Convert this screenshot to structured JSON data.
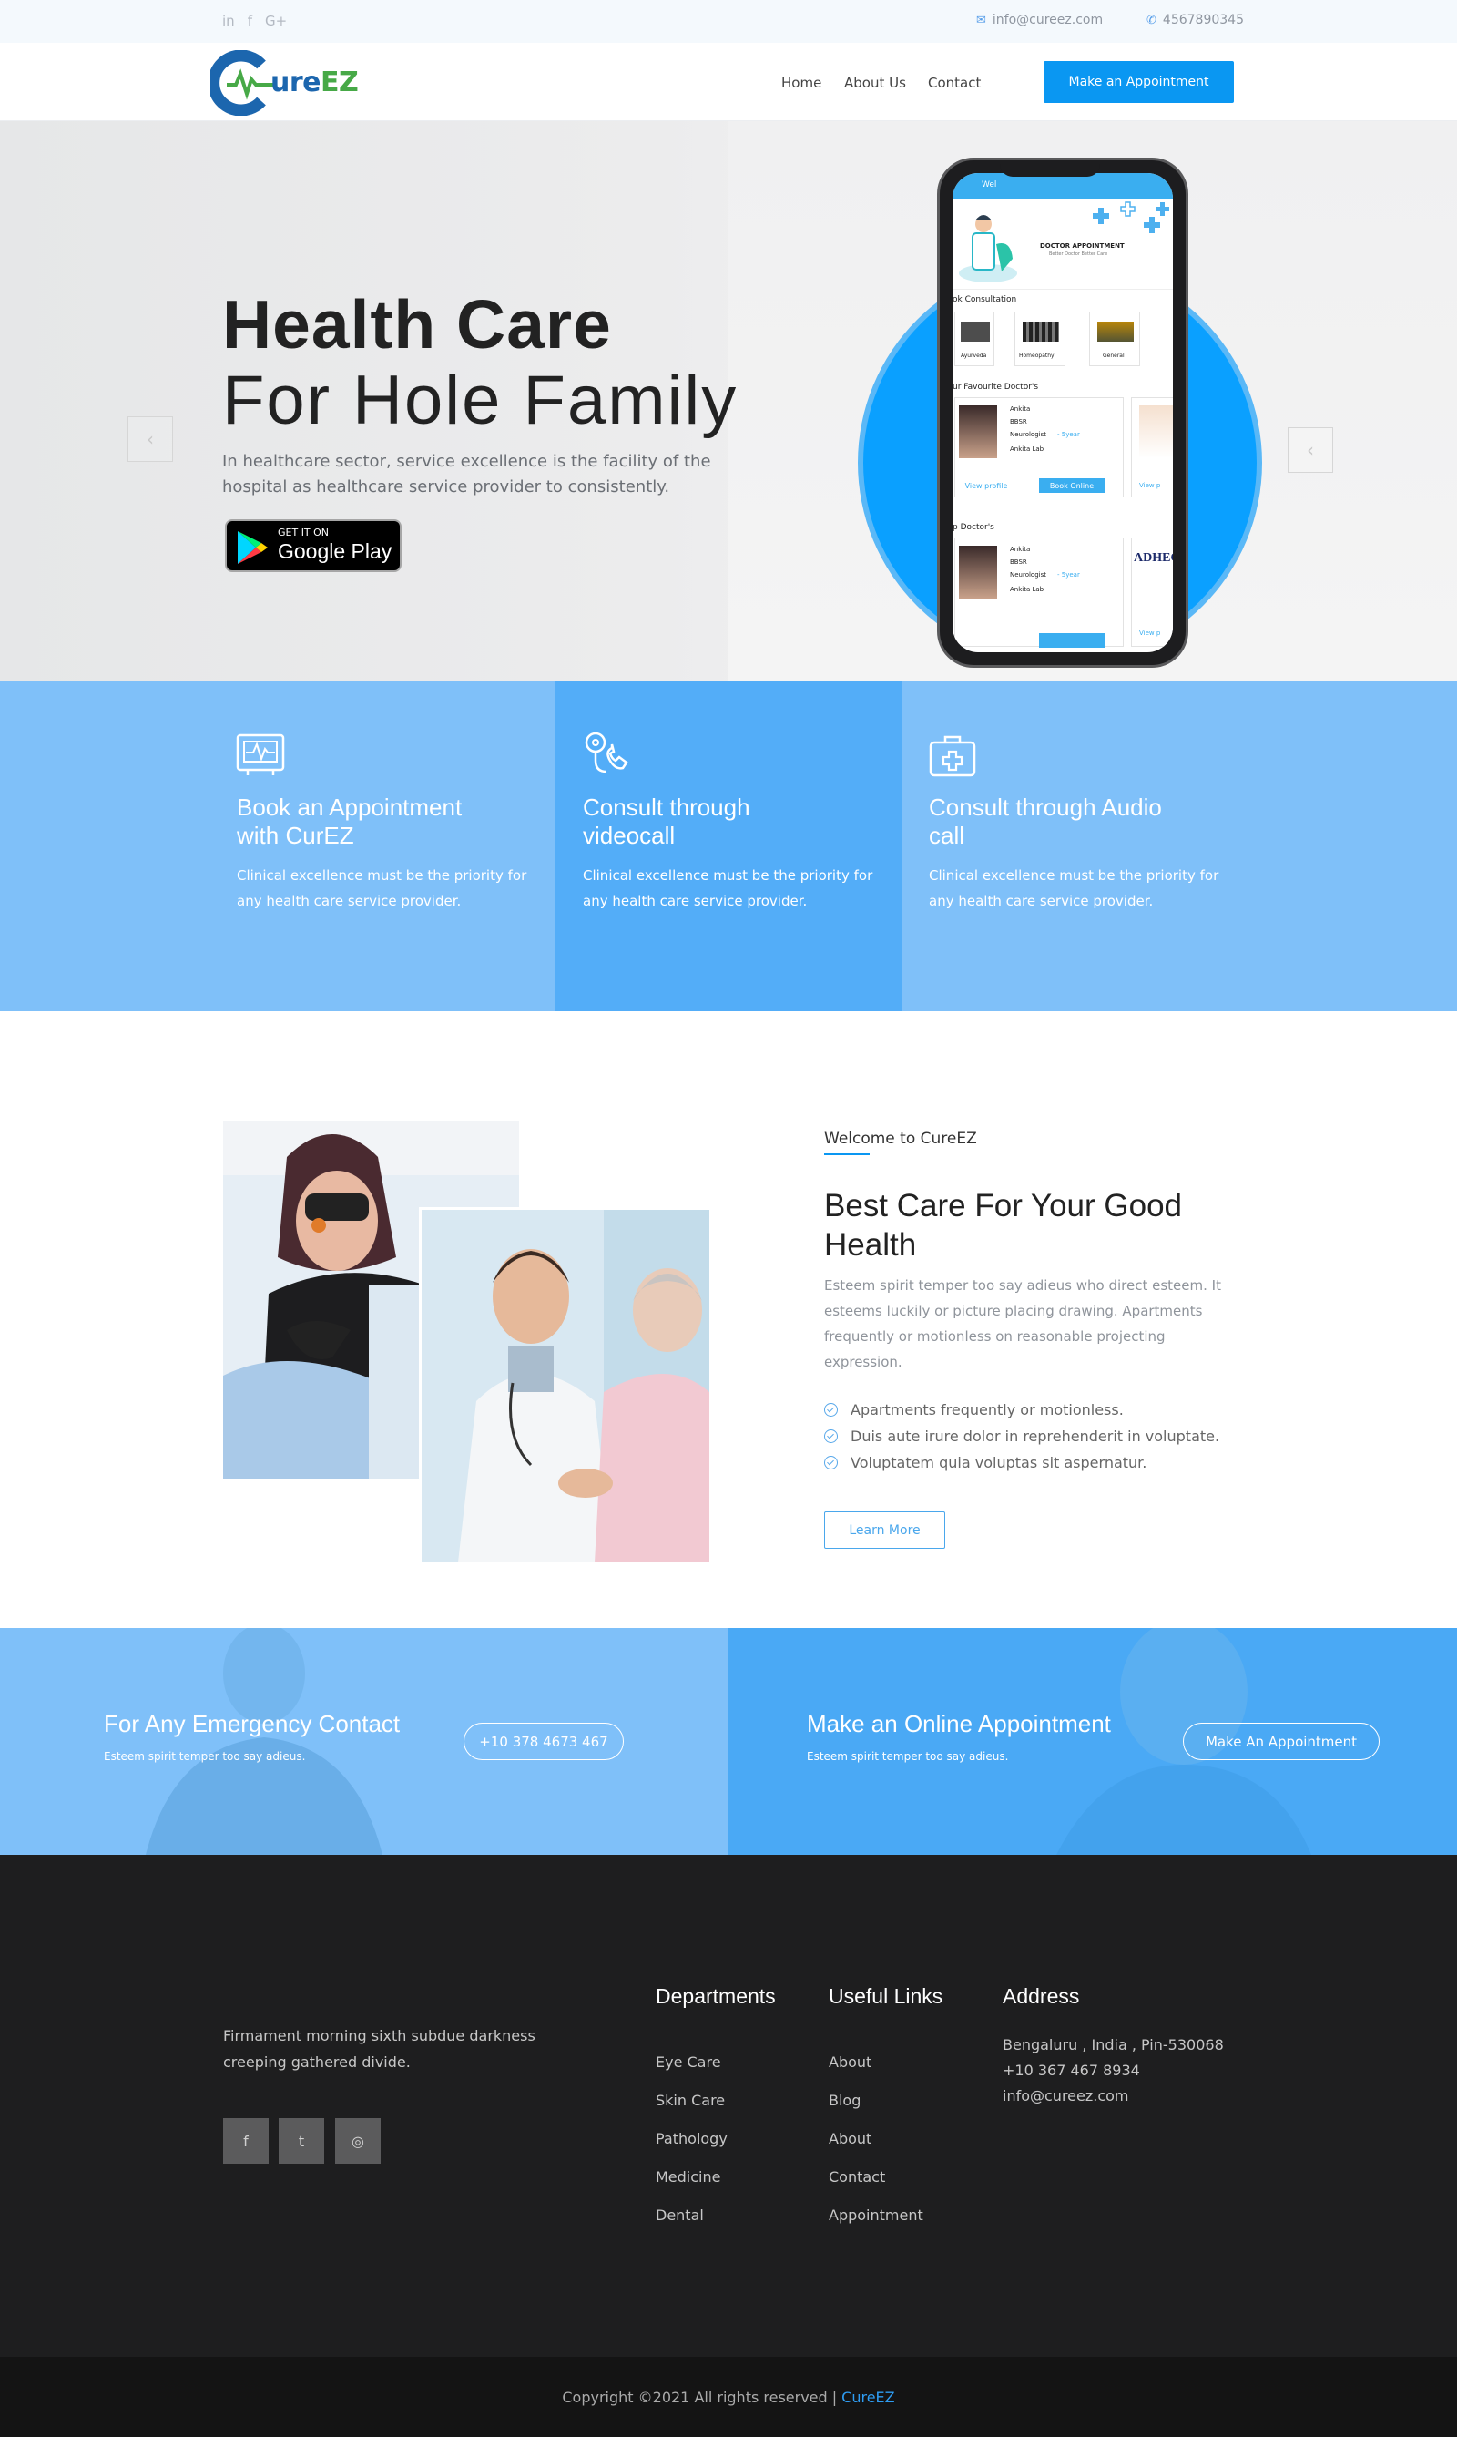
{
  "topbar": {
    "social": [
      "in",
      "f",
      "G+"
    ],
    "email": "info@cureez.com",
    "phone": "4567890345"
  },
  "brand": {
    "logo_text_a": "ure",
    "logo_text_b": "EZ",
    "colors": {
      "primary": "#0a97f2",
      "logo_blue": "#1c66ae",
      "logo_green": "#47a947",
      "feature_light": "#7fc0f9",
      "feature_mid": "#53adf8",
      "footer_bg": "#1e1e1f"
    }
  },
  "nav": {
    "items": [
      "Home",
      "About Us",
      "Contact"
    ],
    "cta": "Make an Appointment"
  },
  "hero": {
    "title_bold": "Health Care",
    "title_light": "For Hole Family",
    "description": "In healthcare sector, service excellence is the facility of the hospital as healthcare service provider to consistently.",
    "store_top": "GET IT ON",
    "store_name": "Google Play",
    "prev_icon": "‹",
    "next_icon": "‹",
    "phone_screen": {
      "header": "Wel",
      "banner_title": "DOCTOR APPOINTMENT",
      "banner_sub": "Better Doctor Better Care",
      "section1": "ok Consultation",
      "categories": [
        "Ayurveda",
        "Homeopathy",
        "General"
      ],
      "section2": "ur Favourite Doctor's",
      "doctor_name": "Ankita",
      "doctor_city": "BBSR",
      "doctor_spec": "Neurologist",
      "doctor_exp": "- 5year",
      "doctor_lab": "Ankita Lab",
      "view_profile": "View profile",
      "book_online": "Book Online",
      "view_short": "View p",
      "section3": "p Doctor's",
      "badge_text": "ADHEC"
    }
  },
  "features": [
    {
      "icon": "monitor-heartbeat-icon",
      "title_l1": "Book an Appointment",
      "title_l2": "with CurEZ",
      "text": "Clinical excellence must be the priority for any health care service provider."
    },
    {
      "icon": "stethoscope-phone-icon",
      "title_l1": "Consult through",
      "title_l2": "videocall",
      "text": "Clinical excellence must be the priority for any health care service provider."
    },
    {
      "icon": "medical-kit-icon",
      "title_l1": "Consult through Audio",
      "title_l2": "call",
      "text": "Clinical excellence must be the priority for any health care service provider."
    }
  ],
  "about": {
    "kicker": "Welcome to CureEZ",
    "title": "Best Care For Your Good Health",
    "description": "Esteem spirit temper too say adieus who direct esteem. It esteems luckily or picture placing drawing. Apartments frequently or motionless on reasonable projecting expression.",
    "list": [
      "Apartments frequently or motionless.",
      "Duis aute irure dolor in reprehenderit in voluptate.",
      "Voluptatem quia voluptas sit aspernatur."
    ],
    "button": "Learn More"
  },
  "cta": {
    "left_title": "For Any Emergency Contact",
    "left_sub": "Esteem spirit temper too say adieus.",
    "left_button": "+10 378 4673 467",
    "right_title": "Make an Online Appointment",
    "right_sub": "Esteem spirit temper too say adieus.",
    "right_button": "Make An Appointment"
  },
  "footer": {
    "tagline": "Firmament morning sixth subdue darkness creeping gathered divide.",
    "social": [
      "f",
      "t",
      "◎"
    ],
    "departments_title": "Departments",
    "departments": [
      "Eye Care",
      "Skin Care",
      "Pathology",
      "Medicine",
      "Dental"
    ],
    "links_title": "Useful Links",
    "links": [
      "About",
      "Blog",
      "About",
      "Contact",
      "Appointment"
    ],
    "address_title": "Address",
    "address": [
      "Bengaluru , India , Pin-530068",
      "+10 367 467 8934",
      "info@cureez.com"
    ],
    "copyright": "Copyright ©2021 All rights reserved |",
    "copyright_brand": "CureEZ"
  }
}
